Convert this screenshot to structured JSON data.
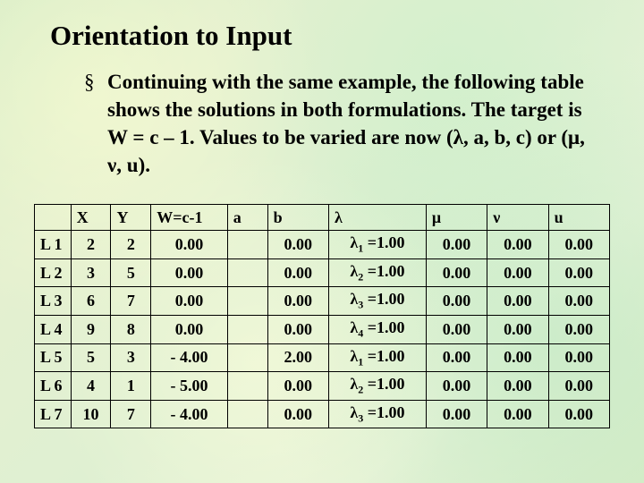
{
  "title": "Orientation to Input",
  "bullet_symbol": "§",
  "body_text": "Continuing with the same example, the following table shows the solutions in both formulations. The target is  W = c – 1. Values to be varied are now (λ, a, b, c) or (μ, ν, u).",
  "table": {
    "headers": [
      "",
      "X",
      "Y",
      "W=c-1",
      "a",
      "b",
      "λ",
      "μ",
      "ν",
      "u"
    ],
    "rows": [
      {
        "label": "L 1",
        "X": "2",
        "Y": "2",
        "W": "0.00",
        "a": "",
        "b": "0.00",
        "lambda_idx": "1",
        "lambda_val": "1.00",
        "mu": "0.00",
        "nu": "0.00",
        "u": "0.00"
      },
      {
        "label": "L 2",
        "X": "3",
        "Y": "5",
        "W": "0.00",
        "a": "",
        "b": "0.00",
        "lambda_idx": "2",
        "lambda_val": "1.00",
        "mu": "0.00",
        "nu": "0.00",
        "u": "0.00"
      },
      {
        "label": "L 3",
        "X": "6",
        "Y": "7",
        "W": "0.00",
        "a": "",
        "b": "0.00",
        "lambda_idx": "3",
        "lambda_val": "1.00",
        "mu": "0.00",
        "nu": "0.00",
        "u": "0.00"
      },
      {
        "label": "L 4",
        "X": "9",
        "Y": "8",
        "W": "0.00",
        "a": "",
        "b": "0.00",
        "lambda_idx": "4",
        "lambda_val": "1.00",
        "mu": "0.00",
        "nu": "0.00",
        "u": "0.00"
      },
      {
        "label": "L 5",
        "X": "5",
        "Y": "3",
        "W": "- 4.00",
        "a": "",
        "b": "2.00",
        "lambda_idx": "1",
        "lambda_val": "1.00",
        "mu": "0.00",
        "nu": "0.00",
        "u": "0.00"
      },
      {
        "label": "L 6",
        "X": "4",
        "Y": "1",
        "W": "- 5.00",
        "a": "",
        "b": "0.00",
        "lambda_idx": "2",
        "lambda_val": "1.00",
        "mu": "0.00",
        "nu": "0.00",
        "u": "0.00"
      },
      {
        "label": "L 7",
        "X": "10",
        "Y": "7",
        "W": "- 4.00",
        "a": "",
        "b": "0.00",
        "lambda_idx": "3",
        "lambda_val": "1.00",
        "mu": "0.00",
        "nu": "0.00",
        "u": "0.00"
      }
    ]
  }
}
